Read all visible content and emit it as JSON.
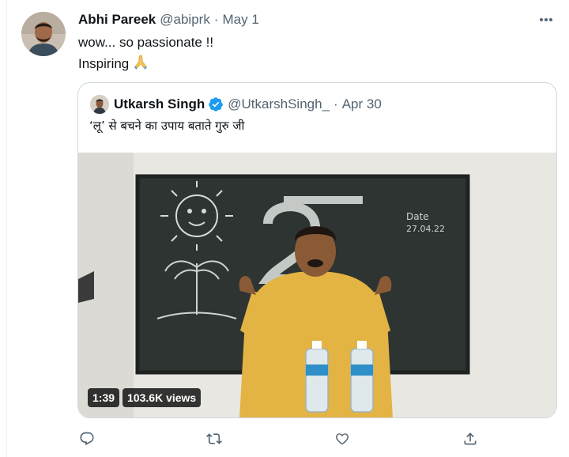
{
  "tweet": {
    "author_name": "Abhi Pareek",
    "author_handle": "@abiprk",
    "separator": "·",
    "date": "May 1",
    "text_line1": "wow... so passionate !!",
    "text_line2": "Inspiring",
    "emoji": "folded-hands",
    "more_icon": "more-horizontal-icon"
  },
  "quoted_tweet": {
    "author_name": "Utkarsh Singh",
    "verified": true,
    "author_handle": "@UtkarshSingh_",
    "separator": "·",
    "date": "Apr 30",
    "text": "‘लू’ से बचने का उपाय बताते गुरु जी",
    "video": {
      "duration": "1:39",
      "views": "103.6K views"
    }
  },
  "actions": [
    {
      "name": "reply",
      "icon": "reply-icon"
    },
    {
      "name": "retweet",
      "icon": "retweet-icon"
    },
    {
      "name": "like",
      "icon": "like-icon"
    },
    {
      "name": "share",
      "icon": "share-icon"
    }
  ],
  "colors": {
    "text_primary": "#0f1419",
    "text_secondary": "#536471",
    "border": "#cfd9de",
    "verified_blue": "#1d9bf0",
    "icon_gray": "#536471"
  }
}
